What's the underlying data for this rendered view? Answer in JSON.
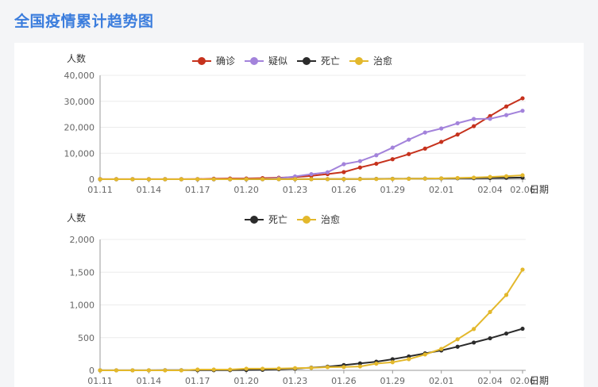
{
  "page": {
    "title": "全国疫情累计趋势图"
  },
  "colors": {
    "title": "#3b7ddd",
    "confirmed": "#c6321d",
    "suspected": "#a383db",
    "death": "#2b2b2b",
    "cured": "#e3b82c"
  },
  "chart_data": [
    {
      "type": "line",
      "ylabel": "人数",
      "xlabel": "日期",
      "ylim": [
        0,
        40000
      ],
      "y_ticks": [
        0,
        10000,
        20000,
        30000,
        40000
      ],
      "y_tick_labels": [
        "0",
        "10,000",
        "20,000",
        "30,000",
        "40,000"
      ],
      "x_tick_labels": [
        "01.11",
        "01.14",
        "01.17",
        "01.20",
        "01.23",
        "01.26",
        "01.29",
        "02.01",
        "02.04",
        "02.06"
      ],
      "x_tick_indices": [
        0,
        3,
        6,
        9,
        12,
        15,
        18,
        21,
        24,
        26
      ],
      "legend_position": "top-center",
      "grid": true,
      "x": [
        "01.11",
        "01.12",
        "01.13",
        "01.14",
        "01.15",
        "01.16",
        "01.17",
        "01.18",
        "01.19",
        "01.20",
        "01.21",
        "01.22",
        "01.23",
        "01.24",
        "01.25",
        "01.26",
        "01.27",
        "01.28",
        "01.29",
        "01.30",
        "01.31",
        "02.01",
        "02.02",
        "02.03",
        "02.04",
        "02.05",
        "02.06"
      ],
      "series": [
        {
          "name": "确诊",
          "color_key": "confirmed",
          "values": [
            41,
            41,
            41,
            41,
            41,
            45,
            62,
            198,
            275,
            291,
            440,
            571,
            830,
            1287,
            1975,
            2744,
            4515,
            5974,
            7711,
            9692,
            11791,
            14380,
            17205,
            20438,
            24324,
            28018,
            31161
          ]
        },
        {
          "name": "疑似",
          "color_key": "suspected",
          "values": [
            0,
            0,
            0,
            0,
            0,
            0,
            0,
            0,
            0,
            54,
            37,
            393,
            1072,
            1965,
            2684,
            5794,
            6973,
            9239,
            12167,
            15238,
            17988,
            19544,
            21558,
            23214,
            23260,
            24702,
            26359
          ]
        },
        {
          "name": "死亡",
          "color_key": "death",
          "values": [
            1,
            1,
            1,
            1,
            2,
            2,
            2,
            3,
            3,
            6,
            9,
            17,
            25,
            41,
            56,
            80,
            106,
            132,
            170,
            213,
            259,
            304,
            361,
            425,
            490,
            563,
            636
          ]
        },
        {
          "name": "治愈",
          "color_key": "cured",
          "values": [
            0,
            0,
            0,
            0,
            0,
            0,
            12,
            12,
            12,
            25,
            25,
            28,
            34,
            38,
            49,
            51,
            60,
            103,
            124,
            171,
            243,
            328,
            475,
            632,
            892,
            1153,
            1540
          ]
        }
      ]
    },
    {
      "type": "line",
      "ylabel": "人数",
      "xlabel": "日期",
      "ylim": [
        0,
        2000
      ],
      "y_ticks": [
        0,
        500,
        1000,
        1500,
        2000
      ],
      "y_tick_labels": [
        "0",
        "500",
        "1,000",
        "1,500",
        "2,000"
      ],
      "x_tick_labels": [
        "01.11",
        "01.14",
        "01.17",
        "01.20",
        "01.23",
        "01.26",
        "01.29",
        "02.01",
        "02.04",
        "02.06"
      ],
      "x_tick_indices": [
        0,
        3,
        6,
        9,
        12,
        15,
        18,
        21,
        24,
        26
      ],
      "legend_position": "top-center",
      "grid": true,
      "x": [
        "01.11",
        "01.12",
        "01.13",
        "01.14",
        "01.15",
        "01.16",
        "01.17",
        "01.18",
        "01.19",
        "01.20",
        "01.21",
        "01.22",
        "01.23",
        "01.24",
        "01.25",
        "01.26",
        "01.27",
        "01.28",
        "01.29",
        "01.30",
        "01.31",
        "02.01",
        "02.02",
        "02.03",
        "02.04",
        "02.05",
        "02.06"
      ],
      "series": [
        {
          "name": "死亡",
          "color_key": "death",
          "values": [
            1,
            1,
            1,
            1,
            2,
            2,
            2,
            3,
            3,
            6,
            9,
            17,
            25,
            41,
            56,
            80,
            106,
            132,
            170,
            213,
            259,
            304,
            361,
            425,
            490,
            563,
            636
          ]
        },
        {
          "name": "治愈",
          "color_key": "cured",
          "values": [
            0,
            0,
            0,
            0,
            0,
            0,
            12,
            12,
            12,
            25,
            25,
            28,
            34,
            38,
            49,
            51,
            60,
            103,
            124,
            171,
            243,
            328,
            475,
            632,
            892,
            1153,
            1540
          ]
        }
      ]
    }
  ]
}
